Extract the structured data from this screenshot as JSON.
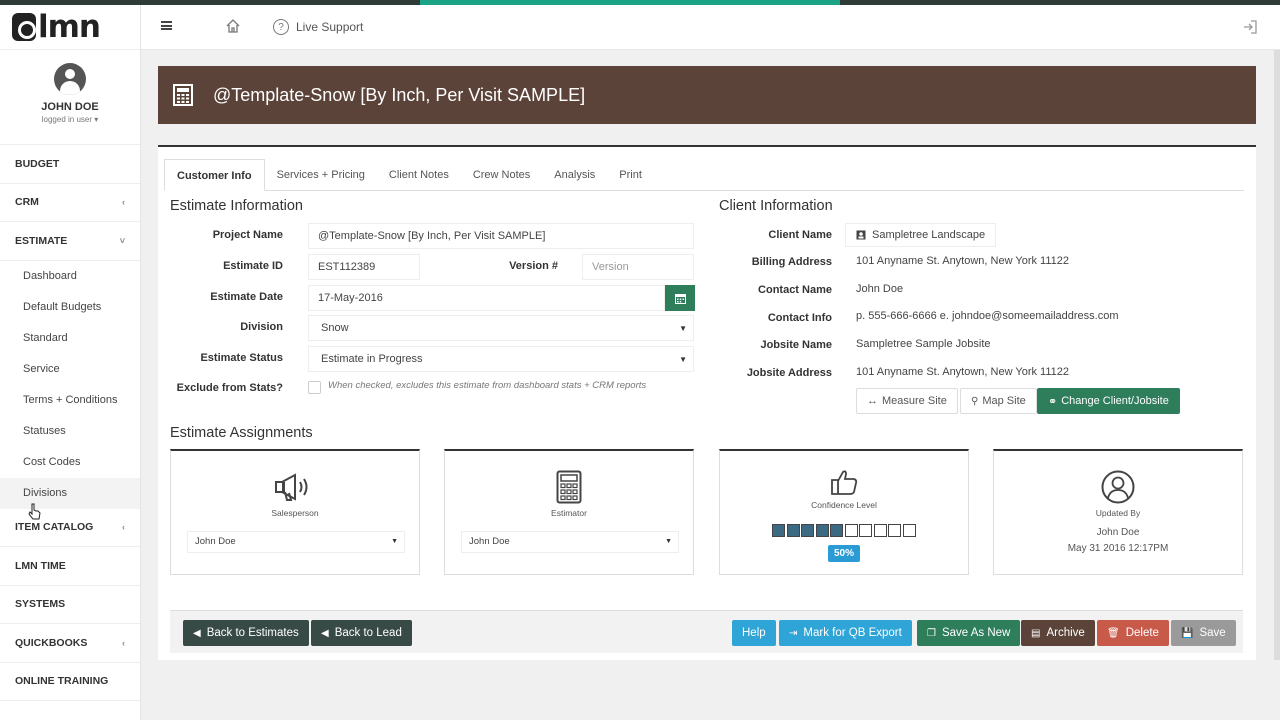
{
  "app": {
    "logo": "lmn"
  },
  "user": {
    "name": "JOHN DOE",
    "sub": "logged in user ▾"
  },
  "sidebar": {
    "sections_top": [
      {
        "label": "BUDGET",
        "chev": ""
      },
      {
        "label": "CRM",
        "chev": "‹"
      },
      {
        "label": "ESTIMATE",
        "chev": "˅"
      }
    ],
    "estimate_items": [
      "Dashboard",
      "Default Budgets",
      "Standard",
      "Service",
      "Terms + Conditions",
      "Statuses",
      "Cost Codes",
      "Divisions"
    ],
    "sections_bottom": [
      {
        "label": "ITEM CATALOG",
        "chev": "‹"
      },
      {
        "label": "LMN TIME",
        "chev": ""
      },
      {
        "label": "SYSTEMS",
        "chev": ""
      },
      {
        "label": "QUICKBOOKS",
        "chev": "‹"
      },
      {
        "label": "ONLINE TRAINING",
        "chev": ""
      }
    ]
  },
  "header": {
    "live_support": "Live Support"
  },
  "page": {
    "title": "@Template-Snow [By Inch, Per Visit SAMPLE]"
  },
  "tabs": [
    "Customer Info",
    "Services + Pricing",
    "Client Notes",
    "Crew Notes",
    "Analysis",
    "Print"
  ],
  "estimate_info": {
    "title": "Estimate Information",
    "project_name_label": "Project Name",
    "project_name": "@Template-Snow [By Inch, Per Visit SAMPLE]",
    "estimate_id_label": "Estimate ID",
    "estimate_id": "EST112389",
    "version_label": "Version #",
    "version_placeholder": "Version",
    "estimate_date_label": "Estimate Date",
    "estimate_date": "17-May-2016",
    "division_label": "Division",
    "division": "Snow",
    "status_label": "Estimate Status",
    "status": "Estimate in Progress",
    "exclude_label": "Exclude from Stats?",
    "exclude_help": "When checked, excludes this estimate from dashboard stats + CRM reports"
  },
  "client_info": {
    "title": "Client Information",
    "client_name_label": "Client Name",
    "client_name": "Sampletree Landscape",
    "billing_label": "Billing Address",
    "billing": "101 Anyname St. Anytown, New York 11122",
    "contact_name_label": "Contact Name",
    "contact_name": "John Doe",
    "contact_info_label": "Contact Info",
    "contact_info": "p. 555-666-6666 e. johndoe@someemailaddress.com",
    "jobsite_name_label": "Jobsite Name",
    "jobsite_name": "Sampletree Sample Jobsite",
    "jobsite_address_label": "Jobsite Address",
    "jobsite_address": "101 Anyname St. Anytown, New York 11122",
    "measure_btn": "Measure Site",
    "map_btn": "Map Site",
    "change_btn": "Change Client/Jobsite"
  },
  "assignments": {
    "title": "Estimate Assignments",
    "salesperson_caption": "Salesperson",
    "salesperson": "John Doe",
    "estimator_caption": "Estimator",
    "estimator": "John Doe",
    "confidence_caption": "Confidence Level",
    "confidence_percent": 50,
    "confidence_label": "50%",
    "confidence_segments_total": 10,
    "updated_caption": "Updated By",
    "updated_by": "John Doe",
    "updated_at": "May 31 2016 12:17PM"
  },
  "footer": {
    "back_estimates": "Back to Estimates",
    "back_lead": "Back to Lead",
    "help": "Help",
    "qb_export": "Mark for QB Export",
    "save_new": "Save As New",
    "archive": "Archive",
    "delete": "Delete",
    "save": "Save"
  },
  "colors": {
    "title_bar": "#5b4339",
    "primary_green": "#2e7d5b",
    "info_blue": "#2ea5d6",
    "danger": "#c85a4a"
  }
}
